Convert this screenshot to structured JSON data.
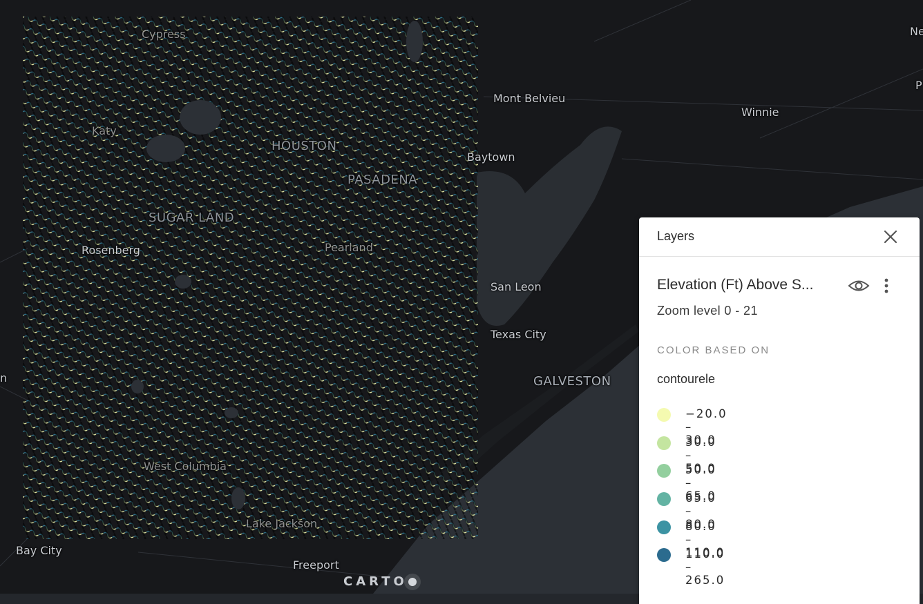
{
  "map": {
    "places": [
      {
        "name": "Cypress"
      },
      {
        "name": "Katy"
      },
      {
        "name": "HOUSTON"
      },
      {
        "name": "Mont Belvieu"
      },
      {
        "name": "Winnie"
      },
      {
        "name": "Baytown"
      },
      {
        "name": "PASADENA"
      },
      {
        "name": "SUGAR LAND"
      },
      {
        "name": "Rosenberg"
      },
      {
        "name": "Pearland"
      },
      {
        "name": "San Leon"
      },
      {
        "name": "Texas City"
      },
      {
        "name": "GALVESTON"
      },
      {
        "name": "West Columbia"
      },
      {
        "name": "Lake Jackson"
      },
      {
        "name": "Bay City"
      },
      {
        "name": "Freeport"
      },
      {
        "name": "Ne"
      },
      {
        "name": "P"
      },
      {
        "name": "n"
      }
    ],
    "attribution": "CARTO",
    "colors": {
      "land": "#17181b",
      "water": "#2c3036",
      "bay": "#2a2e33"
    }
  },
  "layers_panel": {
    "title": "Layers",
    "close_icon": "close-icon",
    "layer": {
      "name": "Elevation (Ft) Above S...",
      "visibility_icon": "eye-icon",
      "menu_icon": "more-vertical-icon",
      "zoom_text": "Zoom level 0 - 21",
      "color_based_on_label": "COLOR BASED ON",
      "color_field": "contourele",
      "legend": [
        {
          "label": "−20.0 – 30.0",
          "color": "#f4fab0"
        },
        {
          "label": "30.0 – 50.0",
          "color": "#c4e5a0"
        },
        {
          "label": "50.0 – 65.0",
          "color": "#93cf9e"
        },
        {
          "label": "65.0 – 80.0",
          "color": "#63b3a3"
        },
        {
          "label": "80.0 – 110.0",
          "color": "#3c93a3"
        },
        {
          "label": "110.0 – 265.0",
          "color": "#2b6b8e"
        }
      ]
    }
  }
}
